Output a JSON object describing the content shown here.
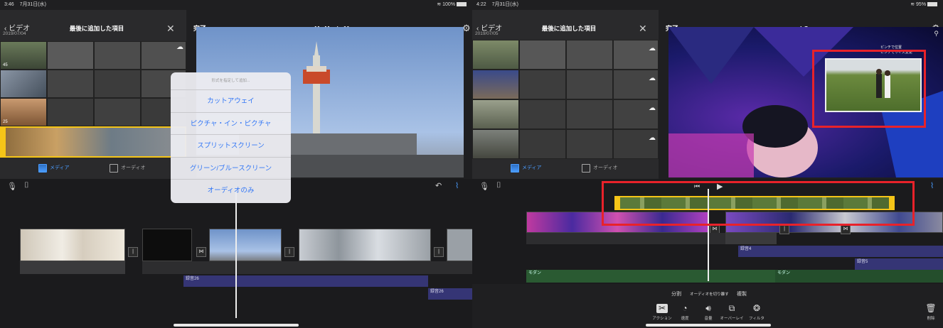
{
  "left": {
    "status": {
      "time": "3:46",
      "date": "7月31日(水)",
      "battery": "100%"
    },
    "browser": {
      "back": "ビデオ",
      "title": "最後に追加した項目",
      "date": "2019/07/04",
      "durations": [
        "45",
        "25"
      ]
    },
    "tabs": {
      "media": "メディア",
      "audio": "オーディオ"
    },
    "project": {
      "done": "完了",
      "title": "My Movie 11",
      "help": "?"
    },
    "popup": {
      "header": "形式を指定して追加...",
      "items": [
        "カットアウェイ",
        "ピクチャ・イン・ピクチャ",
        "スプリットスクリーン",
        "グリーン/ブルースクリーン",
        "オーディオのみ"
      ]
    },
    "audio_clips": [
      "録音26",
      "録音26"
    ]
  },
  "right": {
    "status": {
      "time": "4:22",
      "date": "7月31日(水)",
      "battery": "95%"
    },
    "browser": {
      "back": "ビデオ",
      "title": "最後に追加した項目",
      "date": "2019/07/05"
    },
    "tabs": {
      "media": "メディア",
      "audio": "オーディオ"
    },
    "project": {
      "done": "完了",
      "title": "LG",
      "help": "?"
    },
    "preview_overlay": [
      "ピンチで位置",
      "ピンチでサイズ変更"
    ],
    "audio_clips": [
      "録音4",
      "録音5"
    ],
    "music_clips": [
      "モダン",
      "モダン"
    ],
    "actions": {
      "split": "分割",
      "detach": "オーディオを切り離す",
      "duplicate": "複製"
    },
    "tools": [
      "アクション",
      "速度",
      "音量",
      "オーバーレイ",
      "フィルタ"
    ],
    "delete": "削除"
  },
  "colors": {
    "accent": "#4a9cff",
    "highlight": "#e8222a",
    "clip_trim": "#f5c518",
    "audio": "#353575",
    "music": "#2a5a32"
  }
}
